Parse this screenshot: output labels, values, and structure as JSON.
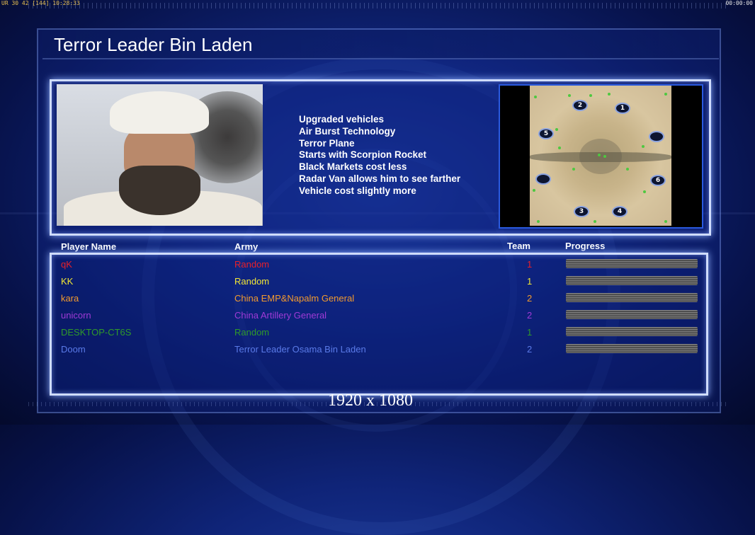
{
  "hud": {
    "left": "UR 30 42 [144] 10:28:33",
    "right": "00:00:00"
  },
  "title": "Terror Leader Bin Laden",
  "traits": [
    "Upgraded vehicles",
    "Air Burst Technology",
    "Terror Plane",
    "Starts with Scorpion Rocket",
    "Black Markets cost less",
    "Radar Van allows him to see farther",
    "Vehicle cost slightly more"
  ],
  "map": {
    "spawns": [
      "2",
      "1",
      "5",
      "",
      "",
      "6",
      "3",
      "4"
    ]
  },
  "table": {
    "headers": {
      "player": "Player Name",
      "army": "Army",
      "team": "Team",
      "progress": "Progress"
    },
    "rows": [
      {
        "name": "qK",
        "army": "Random",
        "team": "1",
        "color": "#e8202a"
      },
      {
        "name": "KK",
        "army": "Random",
        "team": "1",
        "color": "#f2e634"
      },
      {
        "name": "kara",
        "army": "China EMP&Napalm General",
        "team": "2",
        "color": "#f29a2e"
      },
      {
        "name": "unicorn",
        "army": "China Artillery General",
        "team": "2",
        "color": "#a03ad6"
      },
      {
        "name": "DESKTOP-CT6S",
        "army": "Random",
        "team": "1",
        "color": "#2f9a2a"
      },
      {
        "name": "Doom",
        "army": "Terror Leader Osama Bin Laden",
        "team": "2",
        "color": "#5a7ae8"
      }
    ]
  },
  "resolution": "1920 x 1080"
}
